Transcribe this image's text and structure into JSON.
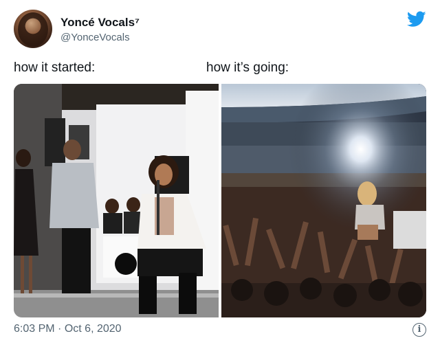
{
  "tweet": {
    "author_name": "Yoncé Vocals⁷",
    "author_handle": "@YonceVocals",
    "caption_left": "how it started:",
    "caption_right": "how it’s going:",
    "time": "6:03 PM",
    "separator": "·",
    "date": "Oct 6, 2020",
    "info_glyph": "i"
  },
  "icons": {
    "brand": "twitter-bird-icon",
    "info": "info-icon"
  },
  "colors": {
    "twitter_blue": "#1d9bf0",
    "text_primary": "#0f1419",
    "text_secondary": "#536471"
  }
}
